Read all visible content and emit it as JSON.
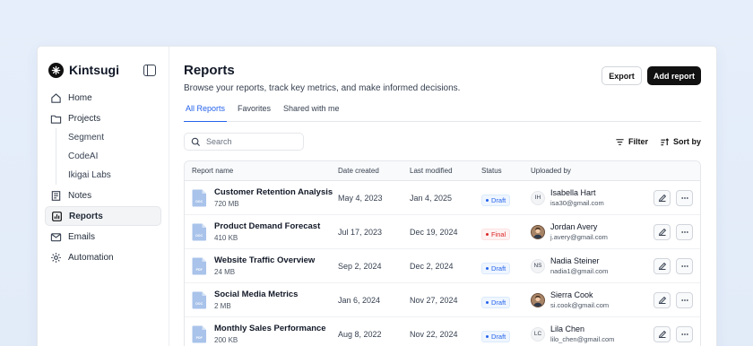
{
  "app": {
    "name": "Kintsugi"
  },
  "sidebar": {
    "items": [
      {
        "label": "Home",
        "icon": "home-icon"
      },
      {
        "label": "Projects",
        "icon": "folder-icon",
        "children": [
          "Segment",
          "CodeAI",
          "Ikigai Labs"
        ]
      },
      {
        "label": "Notes",
        "icon": "notes-icon"
      },
      {
        "label": "Reports",
        "icon": "chart-icon",
        "active": true
      },
      {
        "label": "Emails",
        "icon": "mail-icon"
      },
      {
        "label": "Automation",
        "icon": "gear-icon"
      }
    ]
  },
  "header": {
    "title": "Reports",
    "subtitle": "Browse your reports, track key metrics, and make informed decisions.",
    "export_label": "Export",
    "add_label": "Add report"
  },
  "tabs": [
    {
      "label": "All Reports",
      "active": true
    },
    {
      "label": "Favorites"
    },
    {
      "label": "Shared with me"
    }
  ],
  "toolbar": {
    "search_placeholder": "Search",
    "filter_label": "Filter",
    "sort_label": "Sort by"
  },
  "table": {
    "columns": [
      "Report name",
      "Date created",
      "Last modified",
      "Status",
      "Uploaded by"
    ],
    "rows": [
      {
        "name": "Customer Retention Analysis",
        "size": "720 MB",
        "type": "DOC",
        "created": "May 4, 2023",
        "modified": "Jan 4, 2025",
        "status": "Draft",
        "user": "Isabella Hart",
        "email": "isa30@gmail.com",
        "initials": "IH"
      },
      {
        "name": "Product Demand Forecast",
        "size": "410 KB",
        "type": "DOC",
        "created": "Jul 17, 2023",
        "modified": "Dec 19, 2024",
        "status": "Final",
        "user": "Jordan Avery",
        "email": "j.avery@gmail.com",
        "initials": ""
      },
      {
        "name": "Website Traffic Overview",
        "size": "24 MB",
        "type": "PDF",
        "created": "Sep 2, 2024",
        "modified": "Dec 2, 2024",
        "status": "Draft",
        "user": "Nadia Steiner",
        "email": "nadia1@gmail.com",
        "initials": "NS"
      },
      {
        "name": "Social Media Metrics",
        "size": "2 MB",
        "type": "DOC",
        "created": "Jan 6, 2024",
        "modified": "Nov 27, 2024",
        "status": "Draft",
        "user": "Sierra Cook",
        "email": "si.cook@gmail.com",
        "initials": ""
      },
      {
        "name": "Monthly Sales Performance",
        "size": "200 KB",
        "type": "PDF",
        "created": "Aug 8, 2022",
        "modified": "Nov 22, 2024",
        "status": "Draft",
        "user": "Lila Chen",
        "email": "lilo_chen@gmail.com",
        "initials": "LC"
      }
    ]
  },
  "colors": {
    "accent": "#2563eb",
    "draft": "#2563eb",
    "final": "#dc2626",
    "file_icon": "#a9c3ea"
  }
}
